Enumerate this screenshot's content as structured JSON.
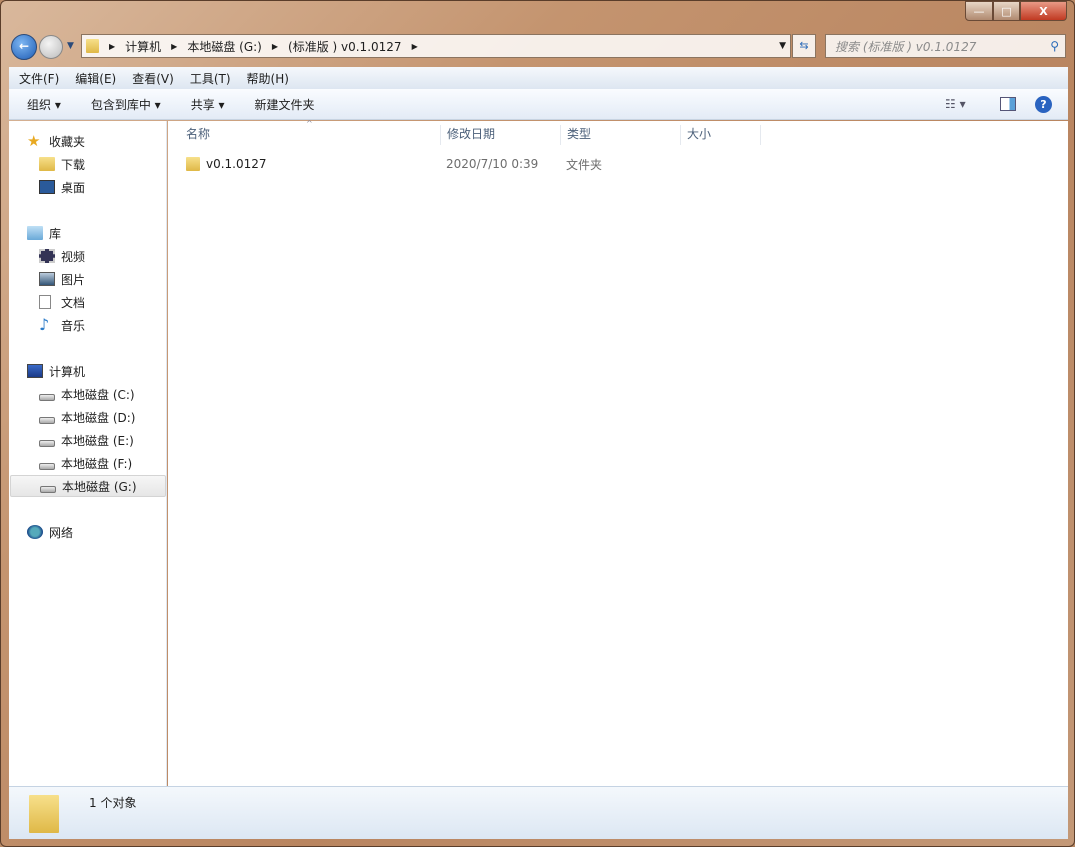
{
  "window": {
    "minimize": "—",
    "maximize": "□",
    "close": "X"
  },
  "address": {
    "segments": [
      "计算机",
      "本地磁盘 (G:)",
      "(标准版 ) v0.1.0127"
    ]
  },
  "search": {
    "placeholder": "搜索 (标准版 ) v0.1.0127"
  },
  "menu": [
    "文件(F)",
    "编辑(E)",
    "查看(V)",
    "工具(T)",
    "帮助(H)"
  ],
  "toolbar": {
    "organize": "组织 ▾",
    "include": "包含到库中 ▾",
    "share": "共享 ▾",
    "new_folder": "新建文件夹"
  },
  "sidebar": {
    "favorites": {
      "label": "收藏夹",
      "items": [
        "下载",
        "桌面"
      ]
    },
    "libraries": {
      "label": "库",
      "items": [
        "视频",
        "图片",
        "文档",
        "音乐"
      ]
    },
    "computer": {
      "label": "计算机",
      "items": [
        "本地磁盘 (C:)",
        "本地磁盘 (D:)",
        "本地磁盘 (E:)",
        "本地磁盘 (F:)",
        "本地磁盘 (G:)"
      ]
    },
    "network": {
      "label": "网络"
    }
  },
  "columns": [
    "名称",
    "修改日期",
    "类型",
    "大小"
  ],
  "files": [
    {
      "name": "v0.1.0127",
      "modified": "2020/7/10 0:39",
      "type": "文件夹",
      "size": ""
    }
  ],
  "status": {
    "count": "1 个对象"
  }
}
